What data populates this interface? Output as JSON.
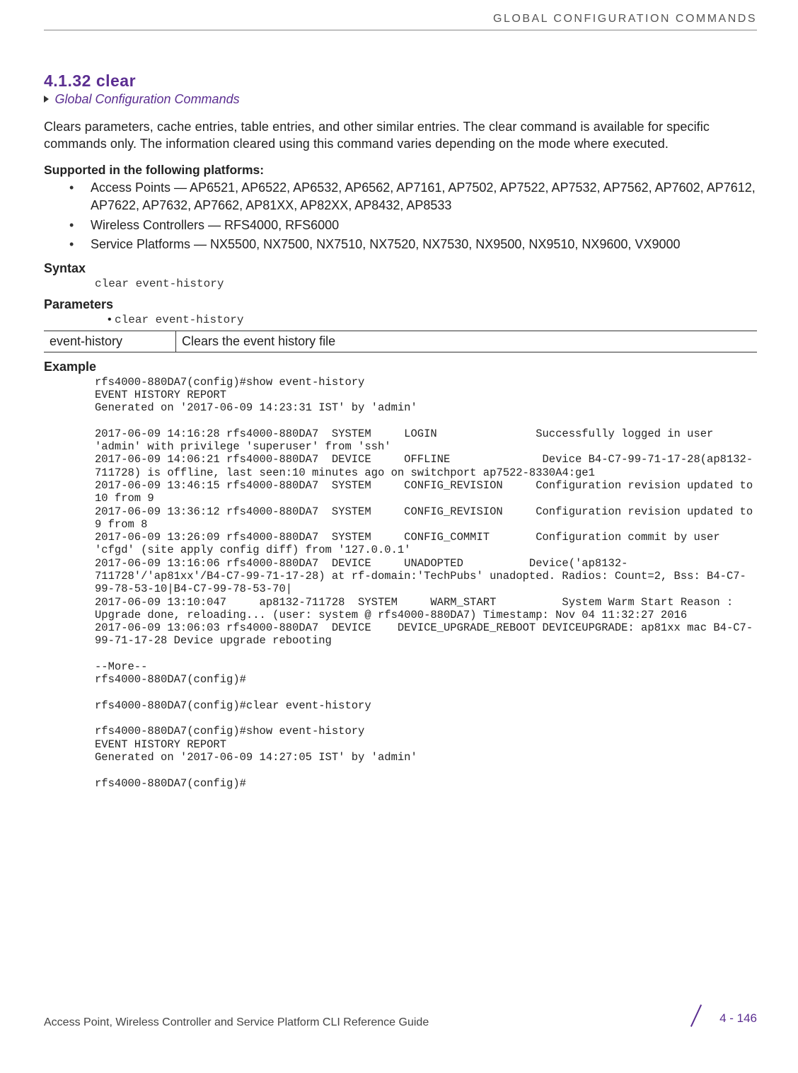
{
  "running_head": "GLOBAL CONFIGURATION COMMANDS",
  "section_number": "4.1.32 clear",
  "breadcrumb_link": "Global Configuration Commands",
  "intro": "Clears parameters, cache entries, table entries, and other similar entries. The clear command is available for specific commands only. The information cleared using this command varies depending on the mode where executed.",
  "supported_heading": "Supported in the following platforms:",
  "platforms": [
    "Access Points — AP6521, AP6522, AP6532, AP6562, AP7161, AP7502, AP7522, AP7532, AP7562, AP7602, AP7612, AP7622, AP7632, AP7662, AP81XX, AP82XX, AP8432, AP8533",
    "Wireless Controllers — RFS4000, RFS6000",
    "Service Platforms — NX5500, NX7500, NX7510, NX7520, NX7530, NX9500, NX9510, NX9600, VX9000"
  ],
  "syntax_label": "Syntax",
  "syntax_text": "clear event-history",
  "parameters_label": "Parameters",
  "param_bullet": "clear event-history",
  "param_table": {
    "name": "event-history",
    "desc": "Clears the event history file"
  },
  "example_label": "Example",
  "example_text": "rfs4000-880DA7(config)#show event-history\nEVENT HISTORY REPORT\nGenerated on '2017-06-09 14:23:31 IST' by 'admin'\n\n2017-06-09 14:16:28 rfs4000-880DA7  SYSTEM     LOGIN               Successfully logged in user 'admin' with privilege 'superuser' from 'ssh'\n2017-06-09 14:06:21 rfs4000-880DA7  DEVICE     OFFLINE              Device B4-C7-99-71-17-28(ap8132-711728) is offline, last seen:10 minutes ago on switchport ap7522-8330A4:ge1\n2017-06-09 13:46:15 rfs4000-880DA7  SYSTEM     CONFIG_REVISION     Configuration revision updated to 10 from 9\n2017-06-09 13:36:12 rfs4000-880DA7  SYSTEM     CONFIG_REVISION     Configuration revision updated to 9 from 8\n2017-06-09 13:26:09 rfs4000-880DA7  SYSTEM     CONFIG_COMMIT       Configuration commit by user 'cfgd' (site apply config diff) from '127.0.0.1'\n2017-06-09 13:16:06 rfs4000-880DA7  DEVICE     UNADOPTED          Device('ap8132-711728'/'ap81xx'/B4-C7-99-71-17-28) at rf-domain:'TechPubs' unadopted. Radios: Count=2, Bss: B4-C7-99-78-53-10|B4-C7-99-78-53-70|\n2017-06-09 13:10:047     ap8132-711728  SYSTEM     WARM_START          System Warm Start Reason : Upgrade done, reloading... (user: system @ rfs4000-880DA7) Timestamp: Nov 04 11:32:27 2016\n2017-06-09 13:06:03 rfs4000-880DA7  DEVICE    DEVICE_UPGRADE_REBOOT DEVICEUPGRADE: ap81xx mac B4-C7-99-71-17-28 Device upgrade rebooting\n\n--More--\nrfs4000-880DA7(config)#\n\nrfs4000-880DA7(config)#clear event-history\n\nrfs4000-880DA7(config)#show event-history\nEVENT HISTORY REPORT\nGenerated on '2017-06-09 14:27:05 IST' by 'admin'\n\nrfs4000-880DA7(config)#",
  "footer": {
    "left": "Access Point, Wireless Controller and Service Platform CLI Reference Guide",
    "page": "4 - 146"
  }
}
